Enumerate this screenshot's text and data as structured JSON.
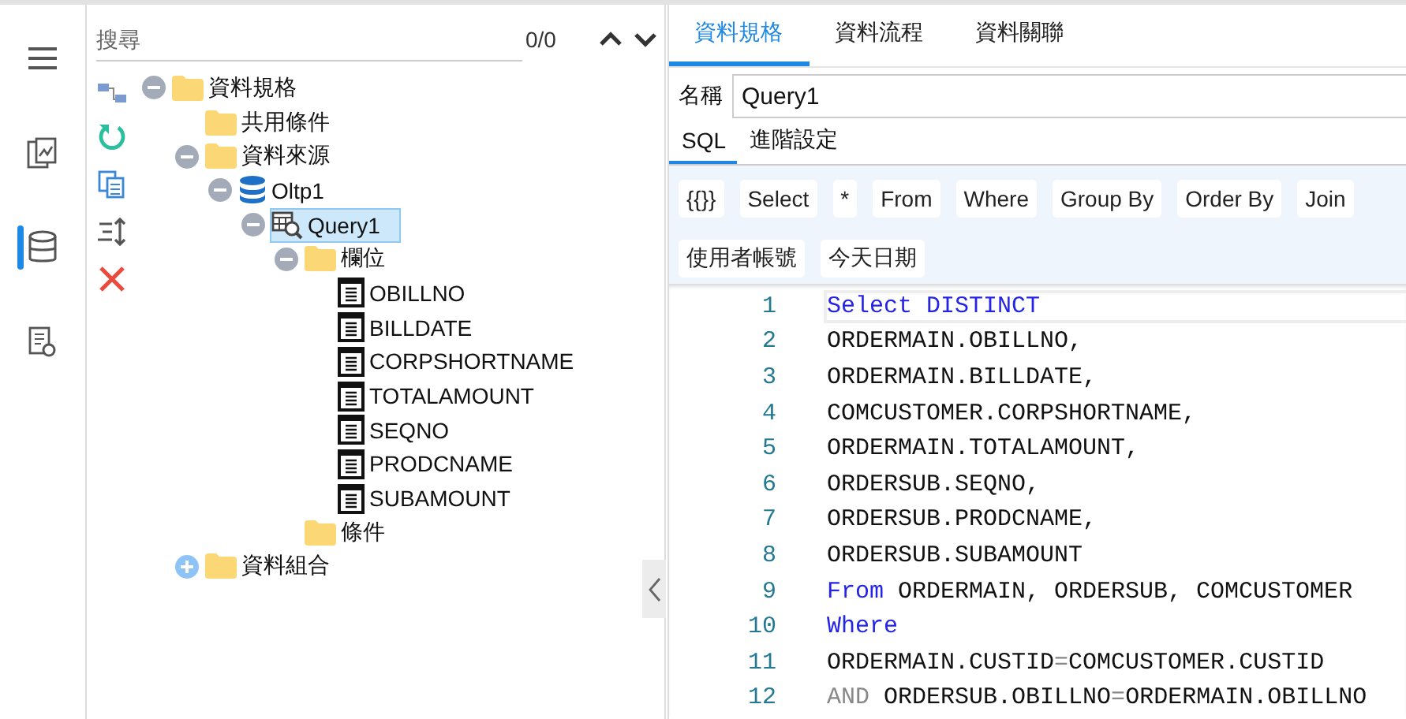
{
  "rail": [
    {
      "kind": "menu",
      "selected": false
    },
    {
      "kind": "report",
      "selected": false
    },
    {
      "kind": "database",
      "selected": true
    },
    {
      "kind": "settings-doc",
      "selected": false
    }
  ],
  "search": {
    "placeholder": "搜尋",
    "count": "0/0"
  },
  "tools": [
    {
      "kind": "diagram"
    },
    {
      "kind": "refresh"
    },
    {
      "kind": "copy"
    },
    {
      "kind": "sort"
    },
    {
      "kind": "delete"
    }
  ],
  "tree": [
    {
      "label": "資料規格",
      "kind": "folder",
      "expanded": true,
      "selected": false,
      "children": [
        {
          "label": "共用條件",
          "kind": "folder",
          "selected": false
        },
        {
          "label": "資料來源",
          "kind": "folder",
          "expanded": true,
          "selected": false,
          "children": [
            {
              "label": "Oltp1",
              "kind": "database",
              "expanded": true,
              "selected": false,
              "children": [
                {
                  "label": "Query1",
                  "kind": "query",
                  "expanded": true,
                  "selected": true,
                  "children": [
                    {
                      "label": "欄位",
                      "kind": "folder",
                      "expanded": true,
                      "selected": false,
                      "children": [
                        {
                          "label": "OBILLNO",
                          "kind": "field",
                          "selected": false
                        },
                        {
                          "label": "BILLDATE",
                          "kind": "field",
                          "selected": false
                        },
                        {
                          "label": "CORPSHORTNAME",
                          "kind": "field",
                          "selected": false
                        },
                        {
                          "label": "TOTALAMOUNT",
                          "kind": "field",
                          "selected": false
                        },
                        {
                          "label": "SEQNO",
                          "kind": "field",
                          "selected": false
                        },
                        {
                          "label": "PRODCNAME",
                          "kind": "field",
                          "selected": false
                        },
                        {
                          "label": "SUBAMOUNT",
                          "kind": "field",
                          "selected": false
                        }
                      ]
                    },
                    {
                      "label": "條件",
                      "kind": "folder",
                      "selected": false
                    }
                  ]
                }
              ]
            }
          ]
        },
        {
          "label": "資料組合",
          "kind": "folder",
          "expanded": false,
          "selected": false
        }
      ]
    }
  ],
  "tabs": [
    {
      "label": "資料規格",
      "selected": true
    },
    {
      "label": "資料流程",
      "selected": false
    },
    {
      "label": "資料關聯",
      "selected": false
    }
  ],
  "name_field": {
    "label": "名稱",
    "value": "Query1"
  },
  "sub_tabs": [
    {
      "label": "SQL",
      "selected": true
    },
    {
      "label": "進階設定",
      "selected": false
    }
  ],
  "snippet_rows": [
    [
      "{{}}",
      "Select",
      "*",
      "From",
      "Where",
      "Group By",
      "Order By",
      "Join"
    ],
    [
      "使用者帳號",
      "今天日期"
    ]
  ],
  "code": [
    {
      "number": "1",
      "current": true,
      "tokens": [
        {
          "text": "Select DISTINCT",
          "kind": "keyword"
        }
      ]
    },
    {
      "number": "2",
      "current": false,
      "tokens": [
        {
          "text": "ORDERMAIN.OBILLNO,",
          "kind": "plain"
        }
      ]
    },
    {
      "number": "3",
      "current": false,
      "tokens": [
        {
          "text": "ORDERMAIN.BILLDATE,",
          "kind": "plain"
        }
      ]
    },
    {
      "number": "4",
      "current": false,
      "tokens": [
        {
          "text": "COMCUSTOMER.CORPSHORTNAME,",
          "kind": "plain"
        }
      ]
    },
    {
      "number": "5",
      "current": false,
      "tokens": [
        {
          "text": "ORDERMAIN.TOTALAMOUNT,",
          "kind": "plain"
        }
      ]
    },
    {
      "number": "6",
      "current": false,
      "tokens": [
        {
          "text": "ORDERSUB.SEQNO,",
          "kind": "plain"
        }
      ]
    },
    {
      "number": "7",
      "current": false,
      "tokens": [
        {
          "text": "ORDERSUB.PRODCNAME,",
          "kind": "plain"
        }
      ]
    },
    {
      "number": "8",
      "current": false,
      "tokens": [
        {
          "text": "ORDERSUB.SUBAMOUNT",
          "kind": "plain"
        }
      ]
    },
    {
      "number": "9",
      "current": false,
      "tokens": [
        {
          "text": "From",
          "kind": "keyword"
        },
        {
          "text": " ORDERMAIN, ORDERSUB, COMCUSTOMER",
          "kind": "plain"
        }
      ]
    },
    {
      "number": "10",
      "current": false,
      "tokens": [
        {
          "text": "Where",
          "kind": "keyword"
        }
      ]
    },
    {
      "number": "11",
      "current": false,
      "tokens": [
        {
          "text": "ORDERMAIN.CUSTID",
          "kind": "plain"
        },
        {
          "text": "=",
          "kind": "operator"
        },
        {
          "text": "COMCUSTOMER.CUSTID",
          "kind": "plain"
        }
      ]
    },
    {
      "number": "12",
      "current": false,
      "tokens": [
        {
          "text": "AND",
          "kind": "operator"
        },
        {
          "text": " ORDERSUB.OBILLNO",
          "kind": "plain"
        },
        {
          "text": "=",
          "kind": "operator"
        },
        {
          "text": "ORDERMAIN.OBILLNO",
          "kind": "plain"
        }
      ]
    }
  ]
}
